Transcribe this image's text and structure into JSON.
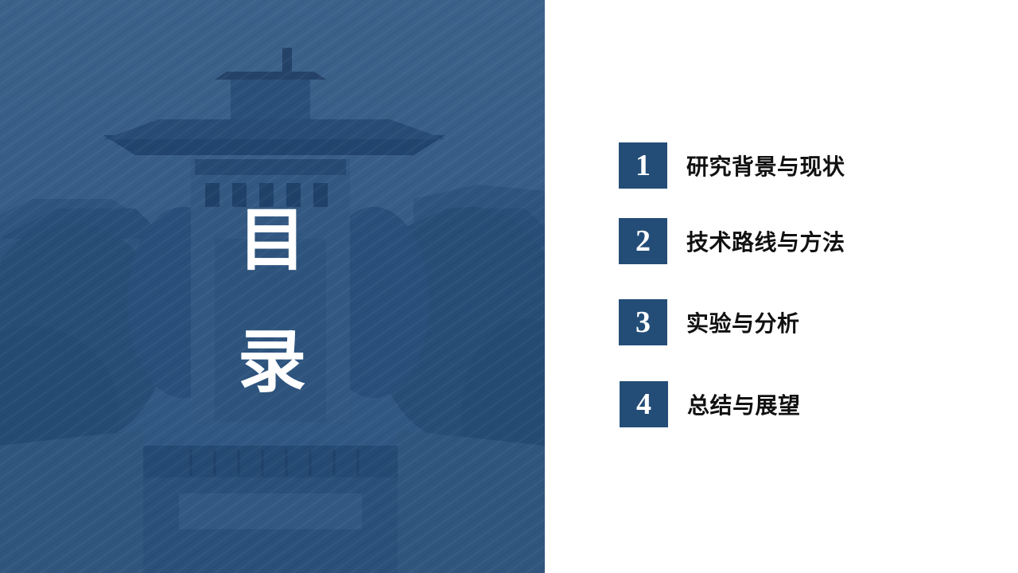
{
  "slide": {
    "title_chars": [
      "目",
      "录"
    ],
    "accent_color": "#234d77",
    "panel_color": "#3b5f86"
  },
  "toc": {
    "items": [
      {
        "number": "1",
        "label": "研究背景与现状"
      },
      {
        "number": "2",
        "label": "技术路线与方法"
      },
      {
        "number": "3",
        "label": "实验与分析"
      },
      {
        "number": "4",
        "label": "总结与展望"
      }
    ]
  },
  "background_image": {
    "icon": "campus-building-illustration"
  }
}
